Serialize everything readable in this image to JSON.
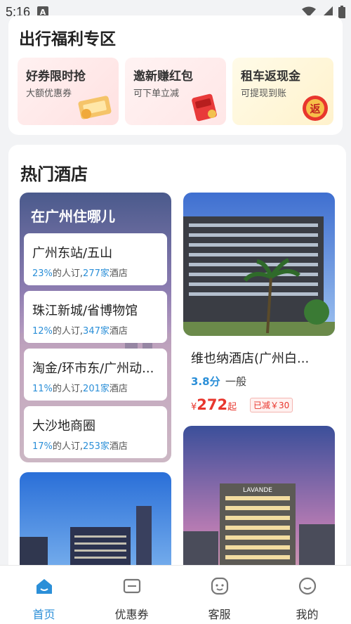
{
  "status_bar": {
    "time": "5:16"
  },
  "promo": {
    "title": "出行福利专区",
    "items": [
      {
        "title": "好券限时抢",
        "subtitle": "大额优惠券"
      },
      {
        "title": "邀新赚红包",
        "subtitle": "可下单立减"
      },
      {
        "title": "租车返现金",
        "subtitle": "可提现到账",
        "badge": "返"
      }
    ]
  },
  "hotels": {
    "title": "热门酒店",
    "area_heading": "在广州住哪儿",
    "areas": [
      {
        "name": "广州东站/五山",
        "percent": "23%",
        "mid": "的人订,",
        "count": "277家",
        "suffix": "酒店"
      },
      {
        "name": "珠江新城/省博物馆",
        "percent": "12%",
        "mid": "的人订,",
        "count": "347家",
        "suffix": "酒店"
      },
      {
        "name": "淘金/环市东/广州动...",
        "percent": "11%",
        "mid": "的人订,",
        "count": "201家",
        "suffix": "酒店"
      },
      {
        "name": "大沙地商圈",
        "percent": "17%",
        "mid": "的人订,",
        "count": "253家",
        "suffix": "酒店"
      }
    ],
    "featured": {
      "name": "维也纳酒店(广州白...",
      "score": "3.8分",
      "level": "一般",
      "currency": "¥",
      "price": "272",
      "price_suffix": "起",
      "discount": "已减￥30"
    },
    "second_sign": "LAVANDE"
  },
  "nav": {
    "items": [
      {
        "label": "首页",
        "icon": "home-icon"
      },
      {
        "label": "优惠券",
        "icon": "coupon-icon"
      },
      {
        "label": "客服",
        "icon": "service-icon"
      },
      {
        "label": "我的",
        "icon": "profile-icon"
      }
    ]
  },
  "colors": {
    "accent": "#2b8fd8",
    "price": "#e8362d"
  }
}
